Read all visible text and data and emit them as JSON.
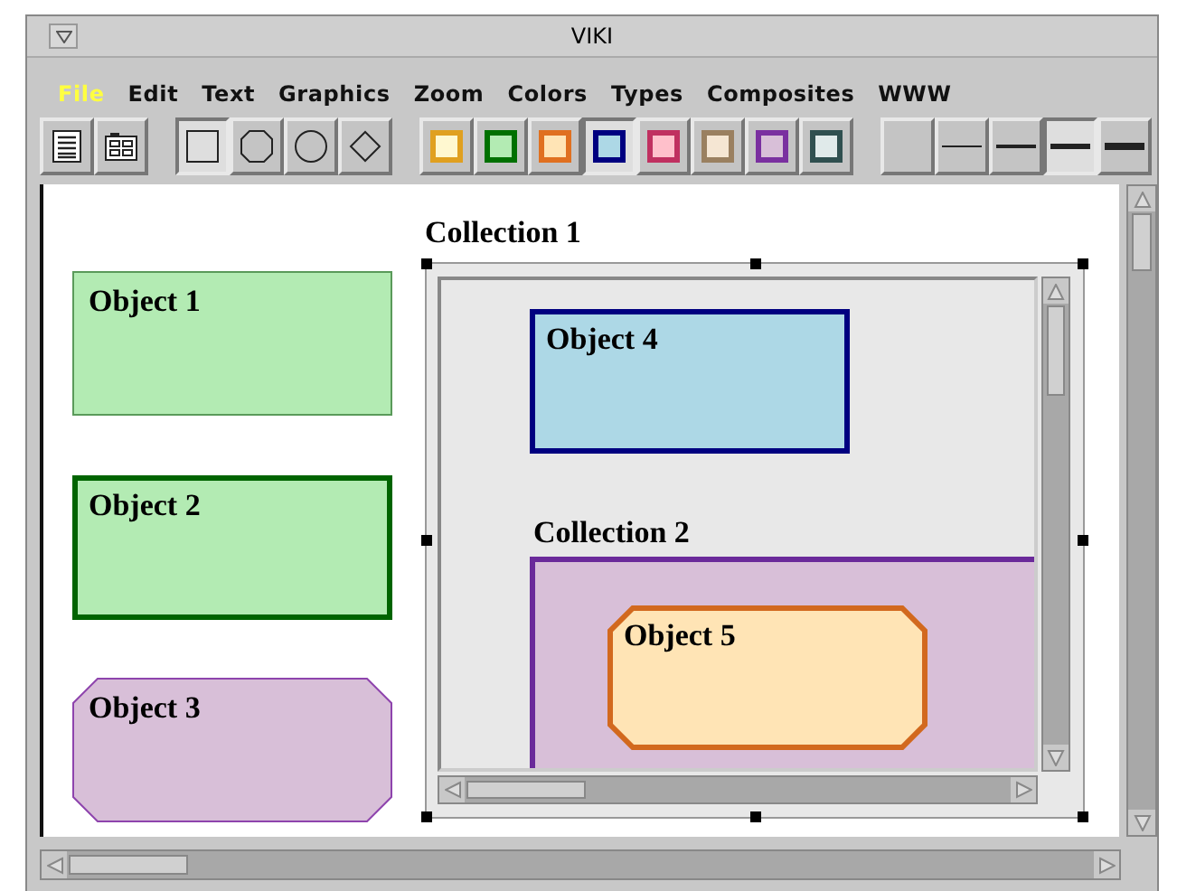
{
  "window": {
    "title": "VIKI"
  },
  "menu": [
    {
      "label": "File",
      "selected": true
    },
    {
      "label": "Edit",
      "selected": false
    },
    {
      "label": "Text",
      "selected": false
    },
    {
      "label": "Graphics",
      "selected": false
    },
    {
      "label": "Zoom",
      "selected": false
    },
    {
      "label": "Colors",
      "selected": false
    },
    {
      "label": "Types",
      "selected": false
    },
    {
      "label": "Composites",
      "selected": false
    },
    {
      "label": "WWW",
      "selected": false
    }
  ],
  "toolbar": {
    "views": [
      {
        "kind": "lines",
        "selected": false
      },
      {
        "kind": "grid",
        "selected": false
      }
    ],
    "shapes": [
      {
        "kind": "rectangle",
        "selected": true
      },
      {
        "kind": "octagon",
        "selected": false
      },
      {
        "kind": "circle",
        "selected": false
      },
      {
        "kind": "diamond",
        "selected": false
      }
    ],
    "colors": [
      {
        "color": "#fff8d0",
        "outline": {
          "color": "#e0a020"
        },
        "selected": false
      },
      {
        "color": "#b3ebb3",
        "outline": {
          "color": "#007000"
        },
        "selected": false
      },
      {
        "color": "#ffe4b5",
        "outline": {
          "color": "#e07020"
        },
        "selected": false
      },
      {
        "color": "#add8e6",
        "outline": {
          "color": "#000080"
        },
        "selected": true
      },
      {
        "color": "#ffc0cb",
        "outline": {
          "color": "#c03060"
        },
        "selected": false
      },
      {
        "color": "#f5e6d3",
        "outline": {
          "color": "#9a8060"
        },
        "selected": false
      },
      {
        "color": "#d8bfd8",
        "outline": {
          "color": "#7a30a0"
        },
        "selected": false
      },
      {
        "color": "#e0eaea",
        "outline": {
          "color": "#305050"
        },
        "selected": false
      }
    ],
    "lines": [
      {
        "kind": "none",
        "selected": false
      },
      {
        "kind": "thin",
        "selected": false
      },
      {
        "kind": "medium",
        "selected": false
      },
      {
        "kind": "thick",
        "selected": true
      },
      {
        "kind": "heavy",
        "selected": false
      }
    ]
  },
  "canvas": {
    "objects": [
      {
        "kind": "rectangle",
        "label": "Object 1",
        "color": "#b3ebb3",
        "outline": {
          "color": "#5a9a5a",
          "thick": false
        }
      },
      {
        "kind": "rectangle",
        "label": "Object 2",
        "color": "#b3ebb3",
        "outline": {
          "color": "#006400",
          "thick": true
        }
      },
      {
        "kind": "octagon",
        "label": "Object 3",
        "color": "#d8bfd8",
        "outline": {
          "color": "#8e44ad",
          "thick": false
        }
      }
    ],
    "collection": {
      "label": "Collection 1",
      "selected": true,
      "objects": [
        {
          "kind": "rectangle",
          "label": "Object 4",
          "color": "#add8e6",
          "outline": {
            "color": "#000080",
            "thick": true
          }
        }
      ],
      "collection": {
        "label": "Collection 2",
        "color": "#d8bfd8",
        "outline": {
          "color": "#6a2a9a"
        },
        "objects": [
          {
            "kind": "octagon",
            "label": "Object 5",
            "color": "#ffe4b5",
            "outline": {
              "color": "#d2691e",
              "thick": true
            }
          }
        ]
      }
    }
  }
}
